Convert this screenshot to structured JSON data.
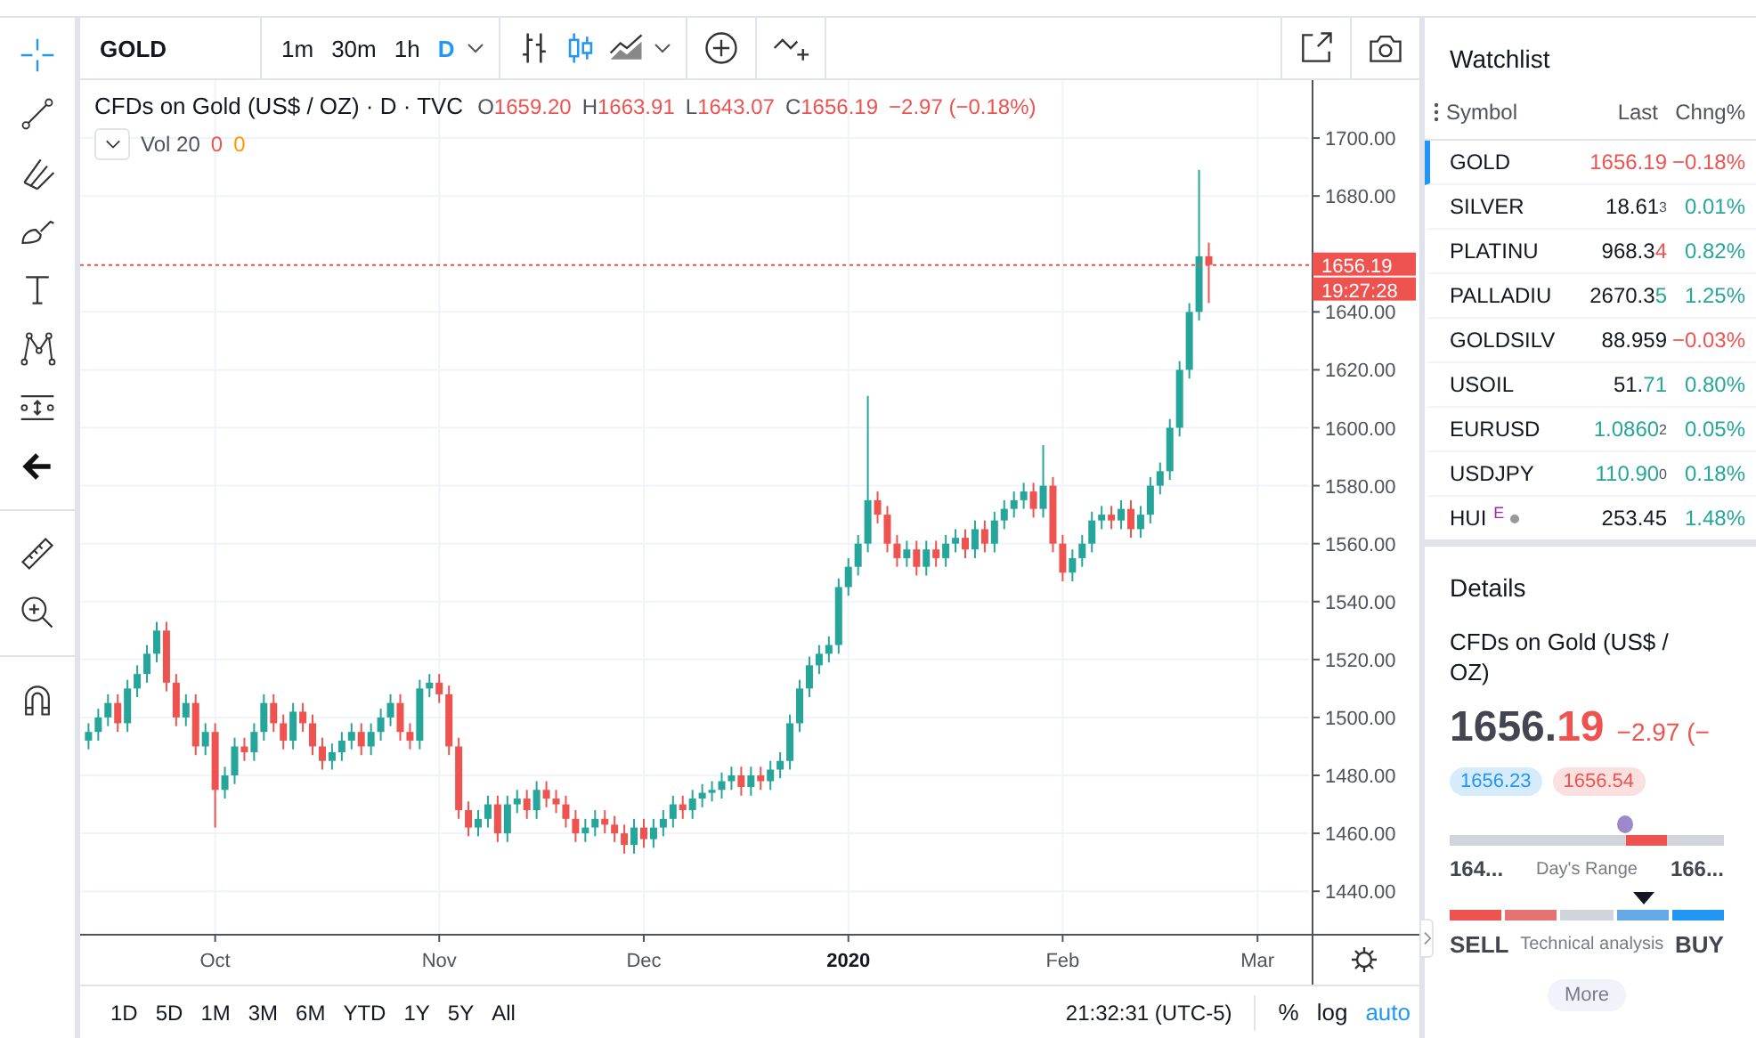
{
  "header": {
    "symbol": "GOLD",
    "intervals": [
      {
        "label": "1m",
        "selected": false
      },
      {
        "label": "30m",
        "selected": false
      },
      {
        "label": "1h",
        "selected": false
      },
      {
        "label": "D",
        "selected": true
      }
    ]
  },
  "legend": {
    "title": "CFDs on Gold (US$ / OZ) · D · TVC",
    "ohlc": [
      {
        "key": "O",
        "value": "1659.20"
      },
      {
        "key": "H",
        "value": "1663.91"
      },
      {
        "key": "L",
        "value": "1643.07"
      },
      {
        "key": "C",
        "value": "1656.19"
      }
    ],
    "change": "−2.97 (−0.18%)",
    "volume": {
      "label": "Vol 20",
      "values": [
        "0",
        "0"
      ]
    }
  },
  "chart_data": {
    "type": "candlestick",
    "grid": true,
    "ylim": [
      1425,
      1720
    ],
    "yticks": [
      {
        "value": 1700,
        "label": "1700.00"
      },
      {
        "value": 1680,
        "label": "1680.00"
      },
      {
        "value": 1640,
        "label": "1640.00"
      },
      {
        "value": 1620,
        "label": "1620.00"
      },
      {
        "value": 1600,
        "label": "1600.00"
      },
      {
        "value": 1580,
        "label": "1580.00"
      },
      {
        "value": 1560,
        "label": "1560.00"
      },
      {
        "value": 1540,
        "label": "1540.00"
      },
      {
        "value": 1520,
        "label": "1520.00"
      },
      {
        "value": 1500,
        "label": "1500.00"
      },
      {
        "value": 1480,
        "label": "1480.00"
      },
      {
        "value": 1460,
        "label": "1460.00"
      },
      {
        "value": 1440,
        "label": "1440.00"
      }
    ],
    "categories": [
      null,
      null,
      null,
      null,
      null,
      null,
      null,
      null,
      null,
      null,
      null,
      null,
      null,
      "Oct",
      null,
      null,
      null,
      null,
      null,
      null,
      null,
      null,
      null,
      null,
      null,
      null,
      null,
      null,
      null,
      null,
      null,
      null,
      null,
      null,
      null,
      null,
      "Nov",
      null,
      null,
      null,
      null,
      null,
      null,
      null,
      null,
      null,
      null,
      null,
      null,
      null,
      null,
      null,
      null,
      null,
      null,
      null,
      null,
      "Dec",
      null,
      null,
      null,
      null,
      null,
      null,
      null,
      null,
      null,
      null,
      null,
      null,
      null,
      null,
      null,
      null,
      null,
      null,
      null,
      null,
      "2020",
      null,
      null,
      null,
      null,
      null,
      null,
      null,
      null,
      null,
      null,
      null,
      null,
      null,
      null,
      null,
      null,
      null,
      null,
      null,
      null,
      null,
      "Feb",
      null,
      null,
      null,
      null,
      null,
      null,
      null,
      null,
      null,
      null,
      null,
      null,
      null,
      null,
      null,
      null,
      null,
      null,
      null,
      "Mar"
    ],
    "ohlc": [
      [
        1492,
        1498,
        1489,
        1495
      ],
      [
        1495,
        1503,
        1492,
        1500
      ],
      [
        1500,
        1508,
        1497,
        1505
      ],
      [
        1505,
        1508,
        1495,
        1498
      ],
      [
        1498,
        1513,
        1495,
        1510
      ],
      [
        1510,
        1518,
        1507,
        1515
      ],
      [
        1515,
        1525,
        1512,
        1522
      ],
      [
        1522,
        1533,
        1519,
        1530
      ],
      [
        1530,
        1533,
        1509,
        1512
      ],
      [
        1512,
        1515,
        1497,
        1500
      ],
      [
        1500,
        1508,
        1497,
        1505
      ],
      [
        1505,
        1508,
        1487,
        1490
      ],
      [
        1490,
        1498,
        1487,
        1495
      ],
      [
        1495,
        1498,
        1462,
        1475
      ],
      [
        1475,
        1483,
        1472,
        1480
      ],
      [
        1480,
        1493,
        1477,
        1490
      ],
      [
        1490,
        1493,
        1485,
        1488
      ],
      [
        1488,
        1498,
        1485,
        1495
      ],
      [
        1495,
        1508,
        1492,
        1505
      ],
      [
        1505,
        1508,
        1495,
        1498
      ],
      [
        1498,
        1501,
        1489,
        1492
      ],
      [
        1492,
        1505,
        1489,
        1502
      ],
      [
        1502,
        1505,
        1495,
        1498
      ],
      [
        1498,
        1501,
        1487,
        1490
      ],
      [
        1490,
        1493,
        1482,
        1485
      ],
      [
        1485,
        1491,
        1482,
        1488
      ],
      [
        1488,
        1495,
        1485,
        1492
      ],
      [
        1492,
        1498,
        1489,
        1495
      ],
      [
        1495,
        1498,
        1487,
        1490
      ],
      [
        1490,
        1498,
        1487,
        1495
      ],
      [
        1495,
        1503,
        1492,
        1500
      ],
      [
        1500,
        1508,
        1497,
        1505
      ],
      [
        1505,
        1508,
        1492,
        1495
      ],
      [
        1495,
        1498,
        1489,
        1492
      ],
      [
        1492,
        1513,
        1489,
        1510
      ],
      [
        1510,
        1515,
        1507,
        1512
      ],
      [
        1512,
        1515,
        1505,
        1508
      ],
      [
        1508,
        1511,
        1487,
        1490
      ],
      [
        1490,
        1493,
        1465,
        1468
      ],
      [
        1468,
        1471,
        1459,
        1462
      ],
      [
        1462,
        1468,
        1459,
        1465
      ],
      [
        1465,
        1473,
        1462,
        1470
      ],
      [
        1470,
        1473,
        1457,
        1460
      ],
      [
        1460,
        1473,
        1457,
        1470
      ],
      [
        1470,
        1475,
        1467,
        1472
      ],
      [
        1472,
        1475,
        1465,
        1468
      ],
      [
        1468,
        1478,
        1465,
        1475
      ],
      [
        1475,
        1478,
        1469,
        1472
      ],
      [
        1472,
        1475,
        1467,
        1470
      ],
      [
        1470,
        1473,
        1462,
        1465
      ],
      [
        1465,
        1468,
        1457,
        1460
      ],
      [
        1460,
        1465,
        1457,
        1462
      ],
      [
        1462,
        1468,
        1459,
        1465
      ],
      [
        1465,
        1468,
        1460,
        1463
      ],
      [
        1463,
        1466,
        1457,
        1460
      ],
      [
        1460,
        1463,
        1453,
        1456
      ],
      [
        1456,
        1465,
        1453,
        1462
      ],
      [
        1462,
        1465,
        1455,
        1458
      ],
      [
        1458,
        1465,
        1455,
        1462
      ],
      [
        1462,
        1468,
        1459,
        1465
      ],
      [
        1465,
        1473,
        1462,
        1470
      ],
      [
        1470,
        1473,
        1465,
        1468
      ],
      [
        1468,
        1475,
        1465,
        1472
      ],
      [
        1472,
        1477,
        1469,
        1474
      ],
      [
        1474,
        1478,
        1471,
        1475
      ],
      [
        1475,
        1481,
        1472,
        1478
      ],
      [
        1478,
        1483,
        1475,
        1480
      ],
      [
        1480,
        1483,
        1473,
        1476
      ],
      [
        1476,
        1483,
        1473,
        1480
      ],
      [
        1480,
        1483,
        1475,
        1478
      ],
      [
        1478,
        1485,
        1475,
        1482
      ],
      [
        1482,
        1488,
        1479,
        1485
      ],
      [
        1485,
        1501,
        1482,
        1498
      ],
      [
        1498,
        1513,
        1495,
        1510
      ],
      [
        1510,
        1521,
        1507,
        1518
      ],
      [
        1518,
        1525,
        1515,
        1522
      ],
      [
        1522,
        1528,
        1519,
        1525
      ],
      [
        1525,
        1548,
        1522,
        1545
      ],
      [
        1545,
        1555,
        1542,
        1552
      ],
      [
        1552,
        1563,
        1549,
        1560
      ],
      [
        1560,
        1611,
        1557,
        1575
      ],
      [
        1575,
        1578,
        1567,
        1570
      ],
      [
        1570,
        1573,
        1557,
        1560
      ],
      [
        1560,
        1563,
        1552,
        1555
      ],
      [
        1555,
        1561,
        1552,
        1558
      ],
      [
        1558,
        1561,
        1549,
        1552
      ],
      [
        1552,
        1561,
        1549,
        1558
      ],
      [
        1558,
        1561,
        1552,
        1555
      ],
      [
        1555,
        1563,
        1552,
        1560
      ],
      [
        1560,
        1565,
        1557,
        1562
      ],
      [
        1562,
        1565,
        1555,
        1558
      ],
      [
        1558,
        1568,
        1555,
        1565
      ],
      [
        1565,
        1568,
        1557,
        1560
      ],
      [
        1560,
        1571,
        1557,
        1568
      ],
      [
        1568,
        1575,
        1565,
        1572
      ],
      [
        1572,
        1578,
        1569,
        1575
      ],
      [
        1575,
        1581,
        1572,
        1578
      ],
      [
        1578,
        1581,
        1569,
        1572
      ],
      [
        1572,
        1594,
        1569,
        1580
      ],
      [
        1580,
        1583,
        1557,
        1560
      ],
      [
        1560,
        1563,
        1547,
        1550
      ],
      [
        1550,
        1558,
        1547,
        1555
      ],
      [
        1555,
        1563,
        1552,
        1560
      ],
      [
        1560,
        1571,
        1557,
        1568
      ],
      [
        1568,
        1573,
        1565,
        1570
      ],
      [
        1570,
        1573,
        1565,
        1568
      ],
      [
        1568,
        1575,
        1565,
        1572
      ],
      [
        1572,
        1575,
        1562,
        1565
      ],
      [
        1565,
        1573,
        1562,
        1570
      ],
      [
        1570,
        1583,
        1567,
        1580
      ],
      [
        1580,
        1588,
        1577,
        1585
      ],
      [
        1585,
        1603,
        1582,
        1600
      ],
      [
        1600,
        1623,
        1597,
        1620
      ],
      [
        1620,
        1643,
        1617,
        1640
      ],
      [
        1640,
        1689,
        1637,
        1659.2
      ],
      [
        1659.2,
        1663.91,
        1643.07,
        1656.19
      ],
      null,
      null,
      null,
      null,
      null
    ],
    "ref_lines": [
      {
        "axis": "y",
        "value": 1656.19,
        "label": "1656.19",
        "color": "#ef5350"
      }
    ]
  },
  "countdown": "19:27:28",
  "ranges": [
    {
      "label": "1D"
    },
    {
      "label": "5D"
    },
    {
      "label": "1M"
    },
    {
      "label": "3M"
    },
    {
      "label": "6M"
    },
    {
      "label": "YTD"
    },
    {
      "label": "1Y"
    },
    {
      "label": "5Y"
    },
    {
      "label": "All"
    }
  ],
  "clock": "21:32:31 (UTC-5)",
  "scale_options": [
    {
      "label": "%",
      "selected": false
    },
    {
      "label": "log",
      "selected": false
    },
    {
      "label": "auto",
      "selected": true
    }
  ],
  "watchlist": {
    "title": "Watchlist",
    "columns": [
      "Symbol",
      "Last",
      "Chng%"
    ],
    "rows": [
      {
        "symbol": "GOLD",
        "selected": true,
        "last": [
          {
            "text": "1656.19",
            "color": "#ef5350"
          }
        ],
        "chng": {
          "text": "−0.18%",
          "color": "#ef5350"
        }
      },
      {
        "symbol": "SILVER",
        "selected": false,
        "last": [
          {
            "text": "18.61",
            "color": "#131722"
          }
        ],
        "pip": "3",
        "chng": {
          "text": "0.01%",
          "color": "#26a69a"
        }
      },
      {
        "symbol": "PLATINU",
        "selected": false,
        "last": [
          {
            "text": "968.3",
            "color": "#131722"
          },
          {
            "text": "4",
            "color": "#ef5350"
          }
        ],
        "chng": {
          "text": "0.82%",
          "color": "#26a69a"
        }
      },
      {
        "symbol": "PALLADIU",
        "selected": false,
        "last": [
          {
            "text": "2670.3",
            "color": "#131722"
          },
          {
            "text": "5",
            "color": "#26a69a"
          }
        ],
        "chng": {
          "text": "1.25%",
          "color": "#26a69a"
        }
      },
      {
        "symbol": "GOLDSILV",
        "selected": false,
        "last": [
          {
            "text": "88.959",
            "color": "#131722"
          }
        ],
        "chng": {
          "text": "−0.03%",
          "color": "#ef5350"
        }
      },
      {
        "symbol": "USOIL",
        "selected": false,
        "last": [
          {
            "text": "51.",
            "color": "#131722"
          },
          {
            "text": "71",
            "color": "#26a69a"
          }
        ],
        "chng": {
          "text": "0.80%",
          "color": "#26a69a"
        }
      },
      {
        "symbol": "EURUSD",
        "selected": false,
        "last": [
          {
            "text": "1.0860",
            "color": "#26a69a"
          }
        ],
        "pip": "2",
        "chng": {
          "text": "0.05%",
          "color": "#26a69a"
        }
      },
      {
        "symbol": "USDJPY",
        "selected": false,
        "last": [
          {
            "text": "110.90",
            "color": "#26a69a"
          }
        ],
        "pip": "0",
        "chng": {
          "text": "0.18%",
          "color": "#26a69a"
        }
      },
      {
        "symbol": "HUI",
        "selected": false,
        "badge": "E",
        "last": [
          {
            "text": "253.45",
            "color": "#131722"
          }
        ],
        "chng": {
          "text": "1.48%",
          "color": "#26a69a"
        }
      }
    ]
  },
  "details": {
    "title": "Details",
    "name": "CFDs on Gold (US$ / OZ)",
    "price_main": "1656.",
    "price_tail": "19",
    "change": "−2.97 (−",
    "bid": "1656.23",
    "ask": "1656.54",
    "day_range": {
      "low": "164...",
      "label": "Day's Range",
      "high": "166...",
      "level": 0.64
    },
    "technical": {
      "sell": "SELL",
      "label": "Technical analysis",
      "buy": "BUY"
    },
    "more": "More"
  }
}
